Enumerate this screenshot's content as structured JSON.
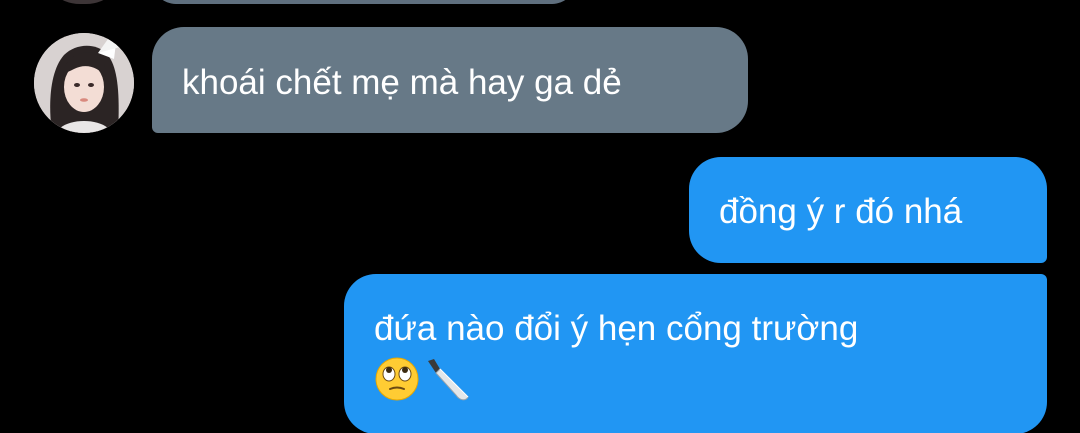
{
  "messages": [
    {
      "direction": "incoming",
      "text": "khoái chết mẹ mà hay ga dẻ"
    },
    {
      "direction": "outgoing",
      "text": "đồng ý r đó nhá"
    },
    {
      "direction": "outgoing",
      "text": "đứa nào đổi ý hẹn cổng trường",
      "emojis": [
        "face-with-rolling-eyes",
        "kitchen-knife"
      ]
    }
  ],
  "colors": {
    "background": "#000000",
    "incoming_bubble": "#677987",
    "outgoing_bubble": "#2196f3",
    "text": "#ffffff"
  }
}
